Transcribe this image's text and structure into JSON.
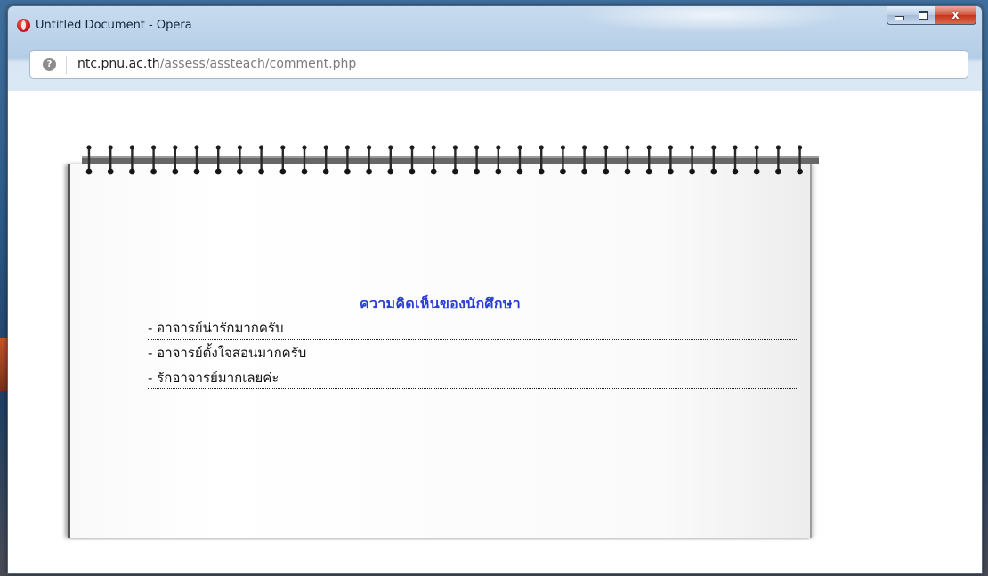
{
  "window": {
    "title": "Untitled Document - Opera",
    "close_symbol": "x"
  },
  "address_bar": {
    "url_domain": "ntc.pnu.ac.th",
    "url_path": "/assess/assteach/comment.php",
    "site_icon_symbol": "?"
  },
  "page": {
    "heading": "ความคิดเห็นของนักศึกษา",
    "comments": [
      "- อาจารย์น่ารักมากครับ",
      "- อาจารย์ตั้งใจสอนมากครับ",
      "- รักอาจารย์มากเลยค่ะ"
    ]
  },
  "colors": {
    "heading": "#2b3fd6",
    "window_frame": "#c8dbef",
    "close_button": "#c4351c"
  },
  "icons": {
    "browser": "opera-icon",
    "site": "site-info-icon",
    "minimize": "minimize-icon",
    "maximize": "maximize-icon",
    "close": "close-icon"
  }
}
